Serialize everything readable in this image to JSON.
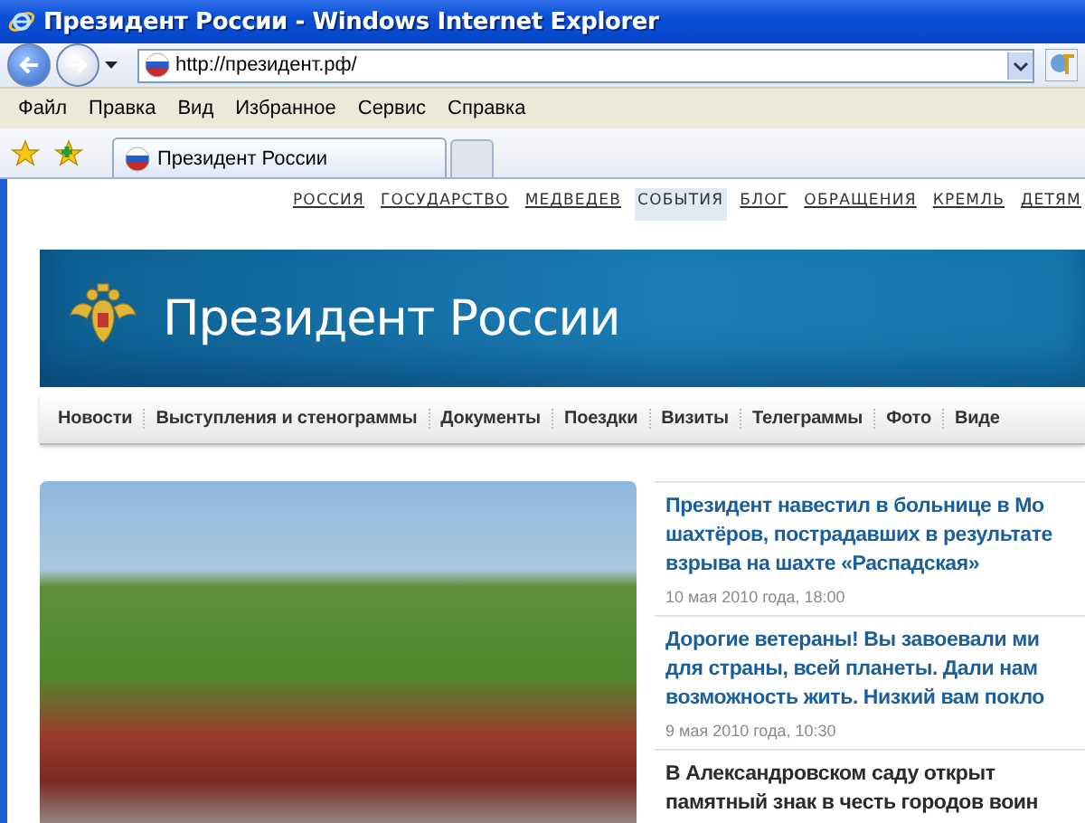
{
  "window": {
    "title": "Президент России - Windows Internet Explorer"
  },
  "address_bar": {
    "value": "http://президент.рф/"
  },
  "menu": [
    "Файл",
    "Правка",
    "Вид",
    "Избранное",
    "Сервис",
    "Справка"
  ],
  "tabs": [
    {
      "label": "Президент России",
      "selected": true
    }
  ],
  "top_links": [
    {
      "label": "РОССИЯ",
      "selected": false
    },
    {
      "label": "ГОСУДАРСТВО",
      "selected": false
    },
    {
      "label": "МЕДВЕДЕВ",
      "selected": false
    },
    {
      "label": "СОБЫТИЯ",
      "selected": true
    },
    {
      "label": "БЛОГ",
      "selected": false
    },
    {
      "label": "ОБРАЩЕНИЯ",
      "selected": false
    },
    {
      "label": "КРЕМЛЬ",
      "selected": false
    },
    {
      "label": "ДЕТЯМ",
      "selected": false
    }
  ],
  "site_title": "Президент России",
  "nav": [
    "Новости",
    "Выступления и стенограммы",
    "Документы",
    "Поездки",
    "Визиты",
    "Телеграммы",
    "Фото",
    "Виде"
  ],
  "news": [
    {
      "headline": "Президент навестил в больнице в Мо\nшахтёров, пострадавших в результате\nвзрыва на шахте «Распадская»",
      "date": "10 мая 2010 года, 18:00",
      "selected": false
    },
    {
      "headline": "Дорогие ветераны! Вы завоевали ми\nдля страны, всей планеты. Дали нам\nвозможность жить. Низкий вам покло",
      "date": "9 мая 2010 года, 10:30",
      "selected": false
    },
    {
      "headline": "В Александровском саду открыт\nпамятный знак в честь городов воин",
      "selected": true
    }
  ]
}
